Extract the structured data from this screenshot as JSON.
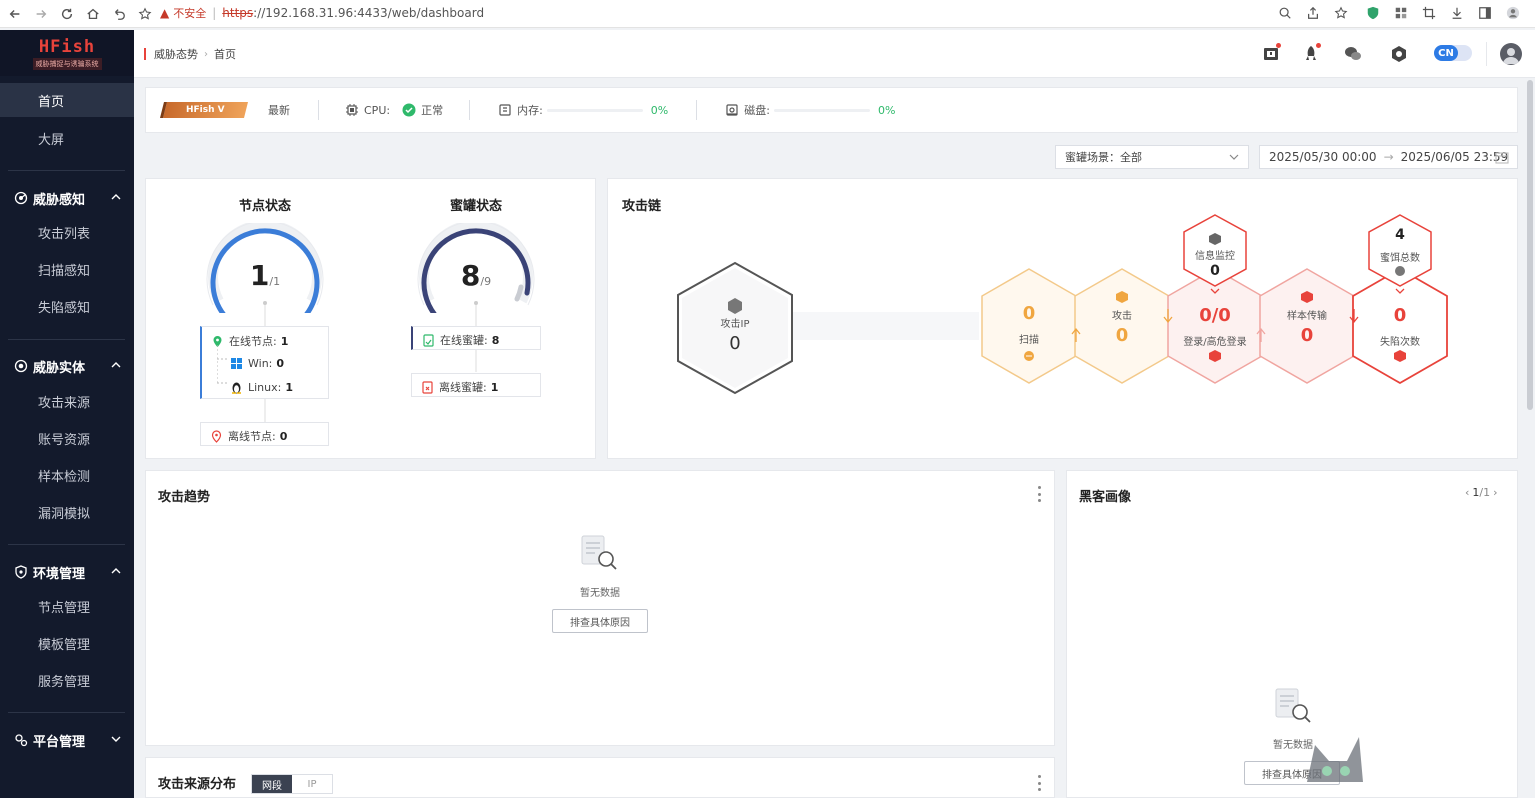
{
  "browser": {
    "insecure_label": "不安全",
    "url_protocol": "https",
    "url_rest": "://192.168.31.96:4433/web/dashboard"
  },
  "sidebar": {
    "brand": "HFish",
    "brand_sub": "威胁捕捉与诱骗系统",
    "top_items": [
      {
        "label": "首页",
        "active": true
      },
      {
        "label": "大屏",
        "active": false
      }
    ],
    "groups": [
      {
        "label": "威胁感知",
        "expanded": true,
        "icon": "radar-icon",
        "items": [
          "攻击列表",
          "扫描感知",
          "失陷感知"
        ]
      },
      {
        "label": "威胁实体",
        "expanded": true,
        "icon": "eye-icon",
        "items": [
          "攻击来源",
          "账号资源",
          "样本检测",
          "漏洞模拟"
        ]
      },
      {
        "label": "环境管理",
        "expanded": true,
        "icon": "shield-icon",
        "items": [
          "节点管理",
          "模板管理",
          "服务管理"
        ]
      },
      {
        "label": "平台管理",
        "expanded": false,
        "icon": "settings-icon",
        "items": []
      }
    ]
  },
  "header": {
    "breadcrumb": [
      "威胁态势",
      "首页"
    ],
    "lang": "CN",
    "accent": "#2d7be5"
  },
  "status": {
    "version": "HFish V",
    "update_label": "最新",
    "cpu_label": "CPU:",
    "cpu_status": "正常",
    "mem_label": "内存:",
    "mem_pct": "0%",
    "disk_label": "磁盘:",
    "disk_pct": "0%"
  },
  "filters": {
    "scene": "蜜罐场景：全部",
    "date_start": "2025/05/30 00:00",
    "date_end": "2025/06/05 23:59"
  },
  "node_status": {
    "title": "节点状态",
    "value": "1",
    "total": "/1",
    "fraction": 1.0,
    "online_label": "在线节点:",
    "online": "1",
    "win_label": "Win:",
    "win": "0",
    "linux_label": "Linux:",
    "linux": "1",
    "offline_label": "离线节点:",
    "offline": "0"
  },
  "honeypot_status": {
    "title": "蜜罐状态",
    "value": "8",
    "total": "/9",
    "fraction": 0.889,
    "online_label": "在线蜜罐:",
    "online": "8",
    "offline_label": "离线蜜罐:",
    "offline": "1"
  },
  "attack_chain": {
    "title": "攻击链",
    "source": {
      "label": "攻击IP",
      "value": "0"
    },
    "stages": [
      {
        "label": "扫描",
        "value": "0",
        "color": "#f0a640"
      },
      {
        "label": "攻击",
        "value": "0",
        "color": "#f0a640"
      },
      {
        "label": "登录/高危登录",
        "value": "0/0",
        "color": "#e8433b"
      },
      {
        "label": "样本传输",
        "value": "0",
        "color": "#e8433b"
      },
      {
        "label": "失陷次数",
        "value": "0",
        "color": "#e8433b"
      }
    ],
    "top_badges": [
      {
        "label": "信息监控",
        "value": "0"
      },
      {
        "label": "蜜饵总数",
        "value": "4"
      }
    ]
  },
  "attack_trend": {
    "title": "攻击趋势",
    "empty_text": "暂无数据",
    "button": "排查具体原因"
  },
  "hacker_profile": {
    "title": "黑客画像",
    "page": "1",
    "pages": "/1",
    "empty_text": "暂无数据",
    "button": "排查具体原因"
  },
  "attack_source": {
    "title": "攻击来源分布",
    "tabs": [
      "网段",
      "IP"
    ]
  }
}
